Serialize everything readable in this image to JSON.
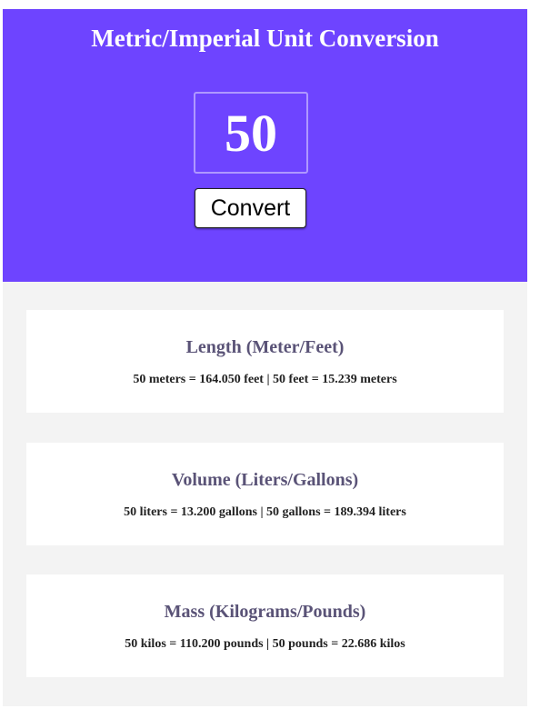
{
  "header": {
    "title": "Metric/Imperial Unit Conversion",
    "input_value": "50",
    "convert_label": "Convert"
  },
  "cards": [
    {
      "title": "Length (Meter/Feet)",
      "text": "50 meters = 164.050 feet | 50 feet = 15.239 meters"
    },
    {
      "title": "Volume (Liters/Gallons)",
      "text": "50 liters = 13.200 gallons | 50 gallons = 189.394 liters"
    },
    {
      "title": "Mass (Kilograms/Pounds)",
      "text": "50 kilos = 110.200 pounds | 50 pounds = 22.686 kilos"
    }
  ],
  "colors": {
    "header_bg": "#6e44ff",
    "results_bg": "#f3f3f3",
    "card_title": "#5a5377"
  }
}
